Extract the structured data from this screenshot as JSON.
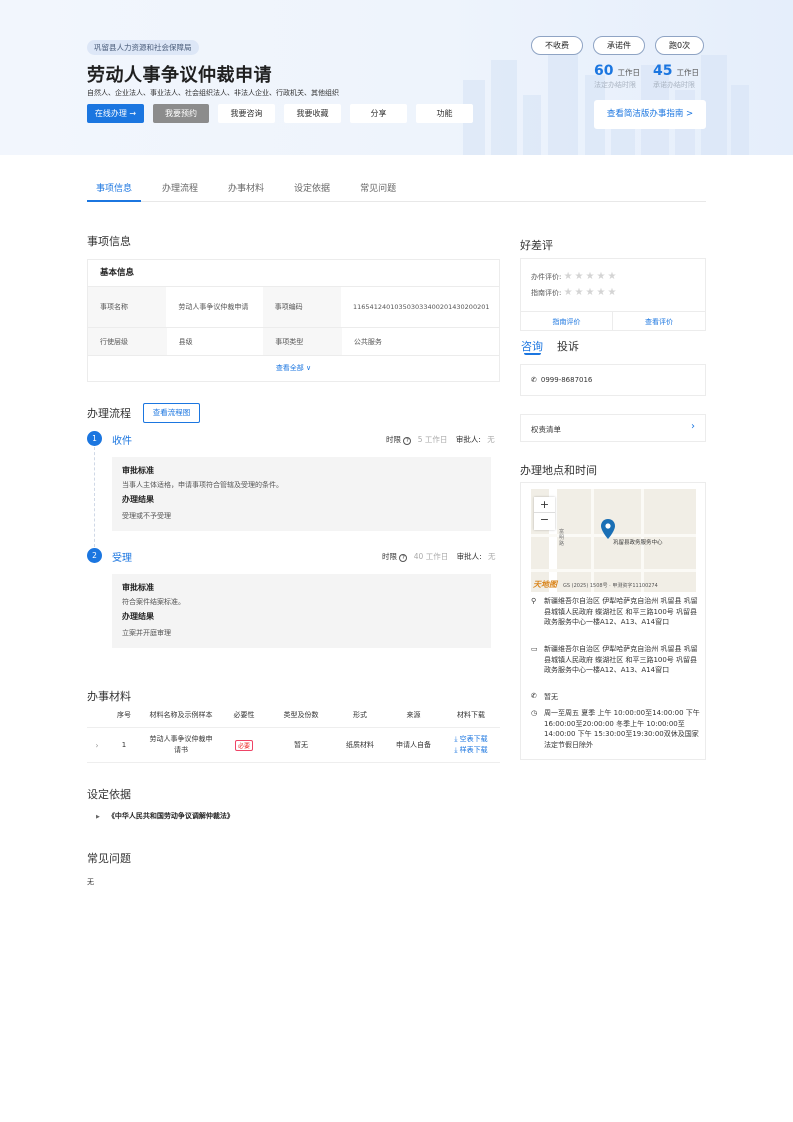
{
  "header": {
    "dept": "巩留县人力资源和社会保障局",
    "title": "劳动人事争议仲裁申请",
    "subjects": "自然人、企业法人、事业法人、社会组织法人、非法人企业、行政机关、其他组织",
    "buttons": {
      "online": "在线办理 →",
      "appoint": "我要预约",
      "consult": "我要咨询",
      "favorite": "我要收藏",
      "share": "分享",
      "function": "功能"
    },
    "pills": {
      "fee": "不收费",
      "promise": "承诺件",
      "trips": "跑0次"
    },
    "stats": {
      "legal_num": "60",
      "legal_unit": "工作日",
      "legal_label": "法定办结时限",
      "promise_num": "45",
      "promise_unit": "工作日",
      "promise_label": "承诺办结时限"
    },
    "guide_button": "查看简洁版办事指南 >"
  },
  "tabs": [
    "事项信息",
    "办理流程",
    "办事材料",
    "设定依据",
    "常见问题"
  ],
  "info": {
    "section_title": "事项信息",
    "basic_title": "基本信息",
    "rows": [
      {
        "k1": "事项名称",
        "v1": "劳动人事争议仲裁申请",
        "k2": "事项编码",
        "v2": "116541240103503033400201430200201"
      },
      {
        "k1": "行使层级",
        "v1": "县级",
        "k2": "事项类型",
        "v2": "公共服务"
      }
    ],
    "more": "查看全部 ∨"
  },
  "process": {
    "section_title": "办理流程",
    "chart_button": "查看流程图",
    "steps": [
      {
        "num": "1",
        "name": "收件",
        "time_label": "时限",
        "time_value": "5 工作日",
        "approver_label": "审批人:",
        "approver": "无",
        "std_label": "审批标准",
        "std": "当事人主体适格，申请事项符合管辖及受理的条件。",
        "result_label": "办理结果",
        "result": "受理或不予受理"
      },
      {
        "num": "2",
        "name": "受理",
        "time_label": "时限",
        "time_value": "40 工作日",
        "approver_label": "审批人:",
        "approver": "无",
        "std_label": "审批标准",
        "std": "符合案件结案标准。",
        "result_label": "办理结果",
        "result": "立案并开庭审理"
      }
    ]
  },
  "materials": {
    "section_title": "办事材料",
    "headers": [
      "序号",
      "材料名称及示例样本",
      "必要性",
      "类型及份数",
      "形式",
      "来源",
      "材料下载"
    ],
    "rows": [
      {
        "idx": "1",
        "name": "劳动人事争议仲裁申请书",
        "required": "必要",
        "type": "暂无",
        "form": "纸质材料",
        "source": "申请人自备",
        "dl_blank": "⤓ 空表下载",
        "dl_sample": "⤓ 样表下载"
      }
    ]
  },
  "basis": {
    "section_title": "设定依据",
    "item": "《中华人民共和国劳动争议调解仲裁法》"
  },
  "faq": {
    "section_title": "常见问题",
    "content": "无"
  },
  "rating": {
    "section_title": "好差评",
    "handle_label": "办件评价:",
    "guide_label": "指南评价:",
    "stars_handle": 0,
    "stars_guide": 0,
    "handle_btn": "指南评价",
    "guide_btn": "查看评价"
  },
  "consult": {
    "tab_active": "咨询",
    "tab_other": "投诉",
    "phone": "0999-8687016"
  },
  "rights": {
    "label": "权责清单"
  },
  "location": {
    "section_title": "办理地点和时间",
    "map_label": "巩留县政务服务中心",
    "map_road": "富明路",
    "map_copyright": "GS (2025) 1508号 · 甲测资字11100274",
    "map_logo": "天地图",
    "address1": "新疆维吾尔自治区 伊犁哈萨克自治州 巩留县 巩留县城镇人民政府 蝶湖社区 和平三路100号 巩留县政务服务中心一楼A12、A13、A14窗口",
    "address2": "新疆维吾尔自治区 伊犁哈萨克自治州 巩留县 巩留县城镇人民政府 蝶湖社区 和平三路100号 巩留县政务服务中心一楼A12、A13、A14窗口",
    "phone": "暂无",
    "hours": "周一至周五 夏季 上午 10:00:00至14:00:00 下午 16:00:00至20:00:00 冬季上午 10:00:00至14:00:00 下午 15:30:00至19:30:00双休及国家法定节假日除外",
    "zoom_in": "+",
    "zoom_out": "−"
  }
}
